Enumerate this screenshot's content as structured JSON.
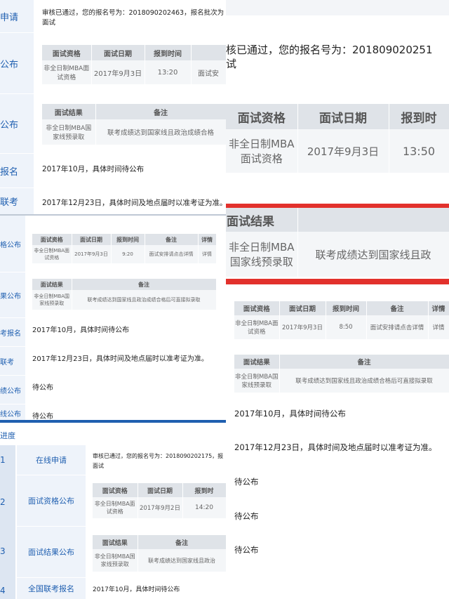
{
  "p1": {
    "side": [
      "申请",
      "公布",
      "公布",
      "报名",
      "联考"
    ],
    "notice": "审核已通过，您的报名号为：2018090202463，报名批次为",
    "notice2": "面试",
    "t1": {
      "headers": [
        "面试资格",
        "面试日期",
        "报到时间"
      ],
      "row": [
        "非全日制MBA面试资格",
        "2017年9月3日",
        "13:20",
        "面试安"
      ]
    },
    "t2": {
      "headers": [
        "面试结果",
        "备注"
      ],
      "row": [
        "非全日制MBA国家线预录取",
        "联考成绩达到国家线且政治成绩合格"
      ]
    },
    "line1": "2017年10月，具体时间待公布",
    "line2": "2017年12月23日，具体时间及地点届时以准考证为准。"
  },
  "p2": {
    "side": [
      "格公布",
      "果公布",
      "考报名",
      "联考",
      "绩公布",
      "线公布"
    ],
    "t1": {
      "headers": [
        "面试资格",
        "面试日期",
        "报到时间",
        "备注",
        "详情"
      ],
      "row": [
        "非全日制MBA面试资格",
        "2017年9月3日",
        "9:20",
        "面试安排请点击详情",
        "详情"
      ]
    },
    "t2": {
      "headers": [
        "面试结果",
        "备注"
      ],
      "row": [
        "非全日制MBA国家线预录取",
        "联考成绩达到国家线且政治成绩合格后可直接拟录取"
      ]
    },
    "line1": "2017年10月，具体时间待公布",
    "line2": "2017年12月23日，具体时间及地点届时以准考证为准。",
    "line3": "待公布",
    "line4": "待公布"
  },
  "p3": {
    "notice": "核已通过，您的报名号为：201809020251",
    "notice2": "试",
    "t1": {
      "headers": [
        "面试资格",
        "面试日期",
        "报到时"
      ],
      "row": [
        "非全日制MBA面试资格",
        "2017年9月3日",
        "13:50"
      ]
    },
    "t2": {
      "headers": [
        "面试结果"
      ],
      "row": [
        "非全日制MBA国家线预录取",
        "联考成绩达到国家线且政"
      ]
    }
  },
  "p4": {
    "t1": {
      "headers": [
        "面试资格",
        "面试日期",
        "报到时间",
        "备注",
        "详情"
      ],
      "row": [
        "非全日制MBA面试资格",
        "2017年9月3日",
        "8:50",
        "面试安排请点击详情",
        "详情"
      ]
    },
    "t2": {
      "headers": [
        "面试结果",
        "备注"
      ],
      "row": [
        "非全日制MBA国家线预录取",
        "联考成绩达到国家线且政治成绩合格后可直接拟录取"
      ]
    },
    "line1": "2017年10月，具体时间待公布",
    "line2": "2017年12月23日，具体时间及地点届时以准考证为准。",
    "line3": "待公布",
    "line4": "待公布",
    "line5": "待公布"
  },
  "p5": {
    "title": "进度",
    "nums": [
      "1",
      "2",
      "3",
      "4"
    ],
    "side": [
      "在线申请",
      "面试资格公布",
      "面试结果公布",
      "全国联考报名"
    ],
    "notice": "审核已通过，您的报名号为：2018090202175，报",
    "notice2": "面试",
    "t1": {
      "headers": [
        "面试资格",
        "面试日期",
        "报到时"
      ],
      "row": [
        "非全日制MBA面试资格",
        "2017年9月2日",
        "14:20"
      ]
    },
    "t2": {
      "headers": [
        "面试结果",
        "备注"
      ],
      "row": [
        "非全日制MBA国家线预录取",
        "联考成绩达到国家线且政治"
      ]
    },
    "line1": "2017年10月，具体时间待公布"
  },
  "colors": {
    "accent": "#1f5fb0",
    "red": "#e2312c",
    "header": "#dfe3e8",
    "sidebar": "#eef3fa"
  }
}
